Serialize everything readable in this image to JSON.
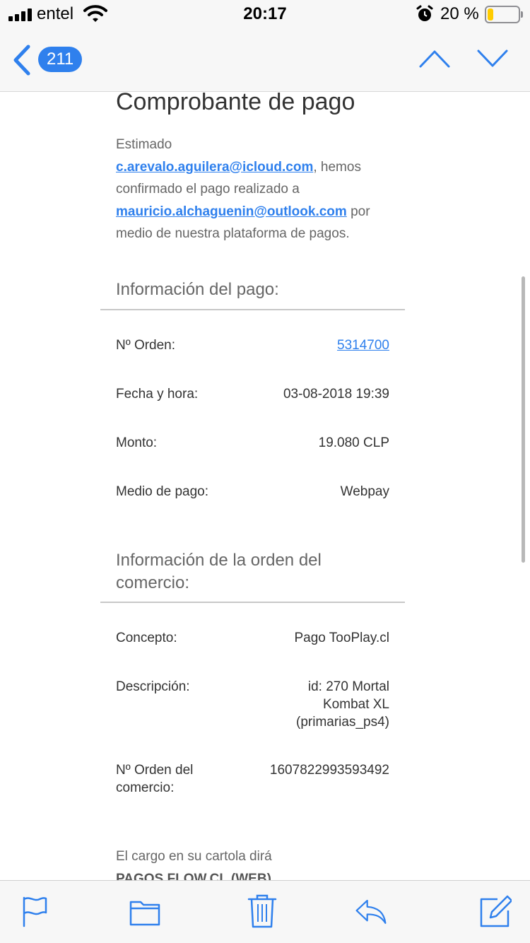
{
  "status_bar": {
    "carrier": "entel",
    "time": "20:17",
    "battery_percent": "20 %",
    "battery_level": 0.2,
    "battery_color": "#ffcc00",
    "icons": [
      "signal-icon",
      "wifi-icon",
      "alarm-icon",
      "battery-icon"
    ]
  },
  "nav": {
    "back_icon": "chevron-left-icon",
    "unread_count": "211",
    "prev_icon": "chevron-up-icon",
    "next_icon": "chevron-down-icon",
    "accent_color": "#2f80ed"
  },
  "email": {
    "title": "Comprobante de pago",
    "intro": {
      "prefix": "Estimado",
      "payer_email": "c.arevalo.aguilera@icloud.com",
      "middle": ", hemos confirmado el pago realizado a",
      "payee_email": "mauricio.alchaguenin@outlook.com",
      "suffix": "por medio de nuestra plataforma de pagos."
    },
    "payment_section": {
      "heading": "Información del pago:",
      "rows": [
        {
          "label": "Nº Orden:",
          "value": "5314700"
        },
        {
          "label": "Fecha y hora:",
          "value": "03-08-2018 19:39"
        },
        {
          "label": "Monto:",
          "value": "19.080 CLP"
        },
        {
          "label": "Medio de pago:",
          "value": "Webpay"
        }
      ]
    },
    "order_section": {
      "heading": "Información de la orden del comercio:",
      "rows": [
        {
          "label": "Concepto:",
          "value": "Pago TooPlay.cl"
        },
        {
          "label": "Descripción:",
          "value_lines": [
            "id: 270 Mortal",
            "Kombat XL",
            "(primarias_ps4)"
          ]
        },
        {
          "label_lines": [
            "Nº Orden del",
            "comercio:"
          ],
          "value": "1607822993593492"
        }
      ]
    },
    "footer": {
      "statement_text": "El cargo en su cartola dirá",
      "statement_name": "PAGOS FLOW.CL (WEB)"
    }
  },
  "toolbar": {
    "icons": [
      "flag-icon",
      "folder-icon",
      "trash-icon",
      "reply-icon",
      "compose-icon"
    ]
  }
}
